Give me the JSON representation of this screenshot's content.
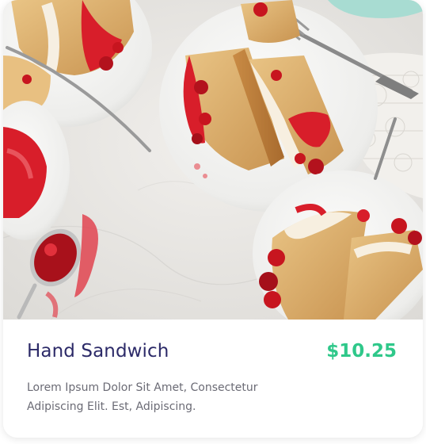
{
  "product": {
    "title": "Hand Sandwich",
    "price": "$10.25",
    "description": "Lorem Ipsum Dolor Sit Amet, Consectetur Adipiscing Elit. Est, Adipiscing."
  },
  "colors": {
    "title": "#2c2a68",
    "price": "#2fc88a",
    "description": "#6b6b75",
    "card_background": "#ffffff",
    "sauce": "#d81e2a",
    "cake": "#e2b574",
    "marble": "#eceae6"
  },
  "image": {
    "subject": "cake-slices-with-cherry-sauce-on-plates"
  }
}
